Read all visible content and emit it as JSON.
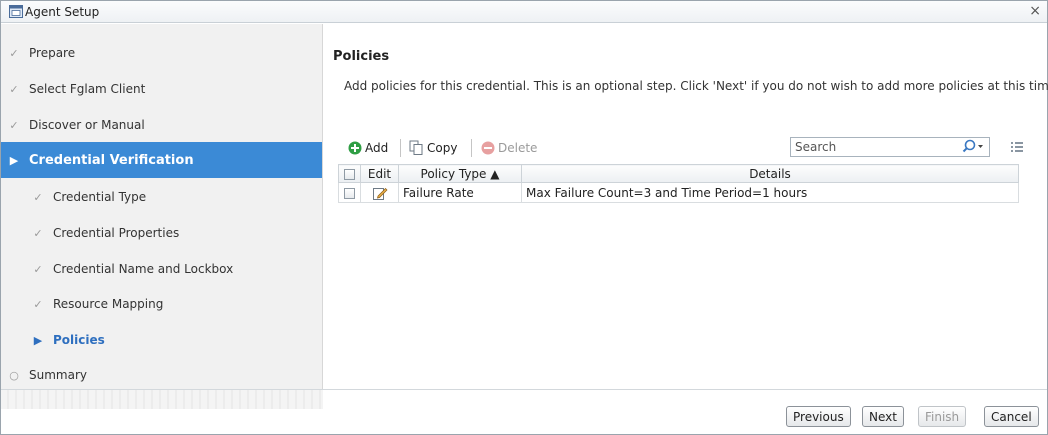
{
  "window": {
    "title": "Agent Setup",
    "close_glyph": "×"
  },
  "steps": [
    {
      "label": "Prepare",
      "mark": "check-icon",
      "glyph": "✓",
      "state": "done"
    },
    {
      "label": "Select Fglam Client",
      "mark": "check-icon",
      "glyph": "✓",
      "state": "done"
    },
    {
      "label": "Discover or Manual",
      "mark": "check-icon",
      "glyph": "✓",
      "state": "done"
    },
    {
      "label": "Credential Verification",
      "mark": "arrow-right-icon",
      "glyph": "▶",
      "state": "active"
    },
    {
      "label": "Credential Type",
      "mark": "check-icon",
      "glyph": "✓",
      "state": "done"
    },
    {
      "label": "Credential Properties",
      "mark": "check-icon",
      "glyph": "✓",
      "state": "done"
    },
    {
      "label": "Credential Name and Lockbox",
      "mark": "check-icon",
      "glyph": "✓",
      "state": "done"
    },
    {
      "label": "Resource Mapping",
      "mark": "check-icon",
      "glyph": "✓",
      "state": "done"
    },
    {
      "label": "Policies",
      "mark": "arrow-right-icon",
      "glyph": "▶",
      "state": "current"
    },
    {
      "label": "Summary",
      "mark": "circle-icon",
      "glyph": "○",
      "state": "pending"
    }
  ],
  "main": {
    "heading": "Policies",
    "description": "Add policies for this credential. This is an optional step. Click 'Next' if you do not wish to add more policies at this time."
  },
  "toolbar": {
    "add_label": "Add",
    "copy_label": "Copy",
    "delete_label": "Delete",
    "search_placeholder": "Search"
  },
  "table": {
    "headers": {
      "edit": "Edit",
      "policy_type": "Policy Type ▲",
      "details": "Details"
    },
    "rows": [
      {
        "policy_type": "Failure Rate",
        "details": "Max Failure Count=3 and Time Period=1 hours"
      }
    ]
  },
  "footer": {
    "previous": "Previous",
    "next": "Next",
    "finish": "Finish",
    "cancel": "Cancel"
  },
  "colors": {
    "active_step": "#3b8ad6",
    "current_step": "#2e6fbf",
    "add_icon": "#2f9e44",
    "delete_icon": "#e7a0a0"
  }
}
